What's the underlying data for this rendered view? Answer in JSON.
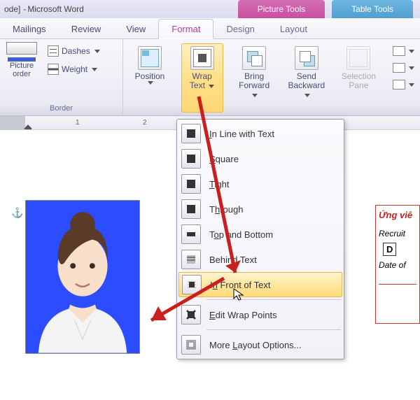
{
  "titlebar": {
    "mode_suffix": "ode]",
    "sep": " - ",
    "app": "Microsoft Word"
  },
  "context_tabs": {
    "picture": "Picture Tools",
    "table": "Table Tools"
  },
  "tabs": {
    "mailings": "Mailings",
    "review": "Review",
    "view": "View",
    "format": "Format",
    "design": "Design",
    "layout": "Layout"
  },
  "ribbon": {
    "border_group_label": "Border",
    "picture_border": {
      "line1": "Picture",
      "line2": "order"
    },
    "dashes": "Dashes",
    "weight": "Weight",
    "position": "Position",
    "wrap_text": {
      "line1": "Wrap",
      "line2": "Text"
    },
    "bring_forward": {
      "line1": "Bring",
      "line2": "Forward"
    },
    "send_backward": {
      "line1": "Send",
      "line2": "Backward"
    },
    "selection_pane": {
      "line1": "Selection",
      "line2": "Pane"
    }
  },
  "ruler": {
    "n1": "1",
    "n2": "2"
  },
  "menu": {
    "inline": "In Line with Text",
    "square": "Square",
    "tight": "Tight",
    "through": "Through",
    "topbottom": "Top and Bottom",
    "behind": "Behind Text",
    "infront": "In Front of Text",
    "editpoints": "Edit Wrap Points",
    "more": "More Layout Options..."
  },
  "textbox": {
    "title": "Ứng viê",
    "recruit": "Recruit",
    "d": "D",
    "date": "Date of"
  },
  "colors": {
    "photo_bg": "#2b4cff",
    "highlight": "#ffdb7a",
    "arrow": "#c9201f"
  }
}
